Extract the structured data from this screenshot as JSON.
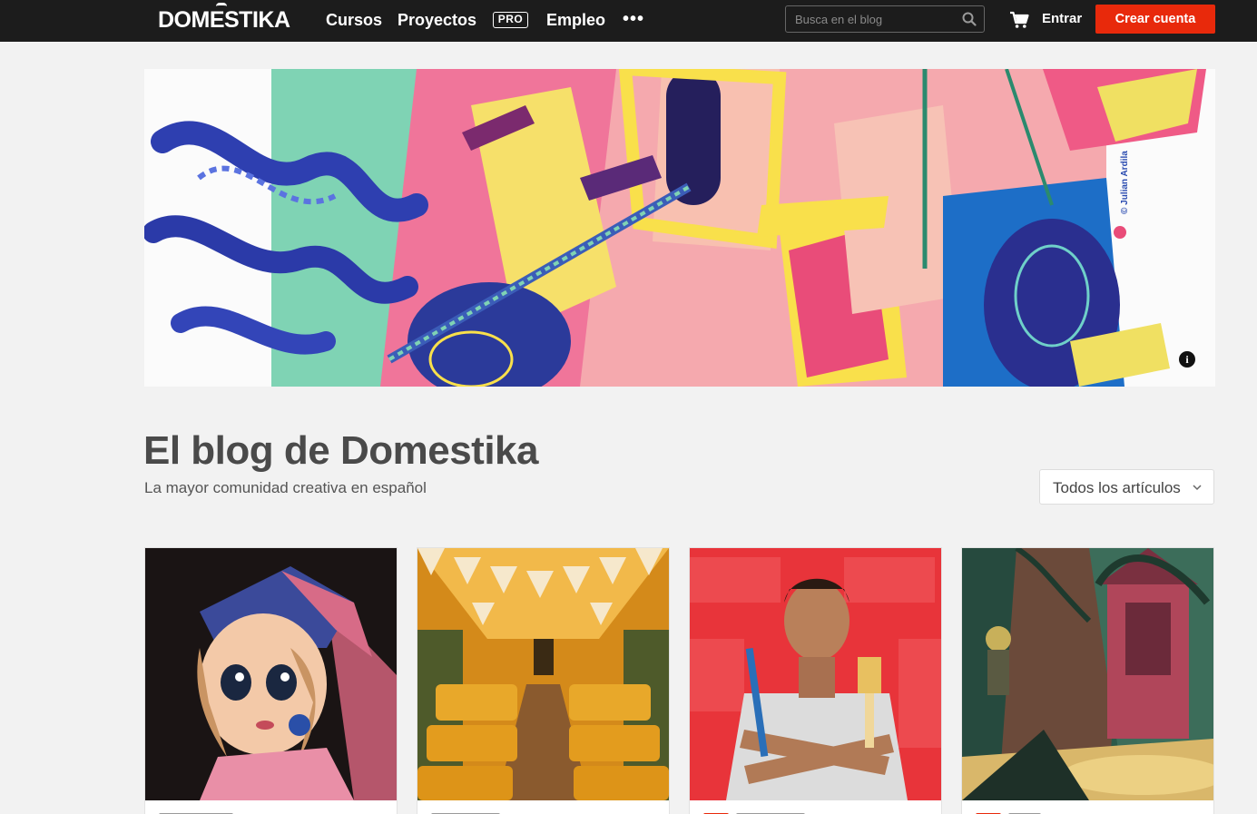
{
  "brand": {
    "logo_text": "DOMESTIKA"
  },
  "nav": {
    "items": [
      {
        "label": "Cursos"
      },
      {
        "label": "Proyectos"
      },
      {
        "label": "PRO"
      },
      {
        "label": "Empleo"
      }
    ],
    "more_label": "•••"
  },
  "search": {
    "placeholder": "Busca en el blog"
  },
  "account": {
    "login_label": "Entrar",
    "signup_label": "Crear cuenta"
  },
  "hero": {
    "credit": "© Julian Ardila",
    "info_label": "i"
  },
  "header": {
    "title": "El blog de Domestika",
    "subtitle": "La mayor comunidad creativa en español"
  },
  "filter": {
    "selected": "Todos los artículos"
  },
  "colors": {
    "accent": "#e8290b",
    "topbar": "#1c1c1c",
    "background": "#f2f2f2"
  },
  "icons": [
    "search-icon",
    "cart-icon",
    "chevron-down-icon",
    "info-icon"
  ]
}
